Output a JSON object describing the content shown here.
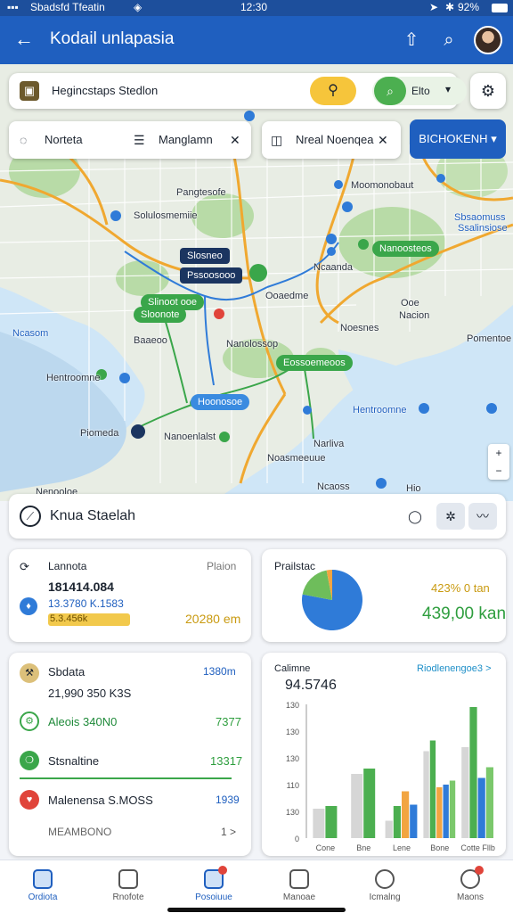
{
  "status": {
    "carrier": "Sbadsfd Tfeatin",
    "time": "12:30",
    "battery": "92%"
  },
  "app": {
    "title": "Kodail unlapasia"
  },
  "search": {
    "value": "Hegincstaps Stedlon",
    "go_label": "Elto"
  },
  "chips": [
    {
      "label": "Norteta"
    },
    {
      "label": "Manglamn"
    },
    {
      "label": "Nreal Noenqea"
    }
  ],
  "directions": {
    "label": "BICHOKENH"
  },
  "map_labels": {
    "l1": "Pangtesofe",
    "l2": "Solulosmemiie",
    "l3": "Moomonobaut",
    "l4": "Sbsaomuss",
    "l5": "Ssalinsiose",
    "l6": "Ncaanda",
    "l7": "Ooaedme",
    "l8": "Ooe",
    "l9": "Nacion",
    "l10": "Noesnes",
    "l11": "Nanolossop",
    "l12": "Pomentoe",
    "l13": "Ncasom",
    "l14": "Hentroomne",
    "l15": "Piomeda",
    "l16": "Nanoenlalst",
    "l17": "Narliva",
    "l18": "Noasmeeuue",
    "l19": "Ncaoss",
    "l20": "Nenooloe",
    "l21": "Hio",
    "l22": "Baaeoo"
  },
  "map_pills": {
    "p1": "Slosneo",
    "p2": "Pssoosooo",
    "p3": "Slinoot ooe",
    "p4": "Sloonote",
    "p5": "Nanoosteos",
    "p6": "Eossoemeoos",
    "p7": "Hoonosoe"
  },
  "location": {
    "title": "Knua Staelah"
  },
  "stats_card": {
    "label": "Lannota",
    "sub": "Plaion",
    "v1": "181414.084",
    "v2": "13.3780 K.1583",
    "v3": "5.3.456k",
    "v4": "20280 em"
  },
  "pie_card": {
    "title": "Prailstac",
    "pct": "423% 0 tan",
    "total": "439,00 kan"
  },
  "list_card": {
    "rows": [
      {
        "label": "Sbdata",
        "value": "1380m",
        "sub": "21,990 350 K3S"
      },
      {
        "label": "Aleois 340N0",
        "value": "7377"
      },
      {
        "label": "Stsnaltine",
        "value": "13317"
      },
      {
        "label": "Malenensa S.MOSS",
        "value": "1939"
      },
      {
        "label": "MEAMBONO",
        "value": "1 >"
      }
    ]
  },
  "chart_card": {
    "title": "Calimne",
    "link": "Riodlenengoe3 >",
    "big_value": "94.5746"
  },
  "chart_data": {
    "type": "bar",
    "categories": [
      "Cone",
      "Bne",
      "Lene",
      "Bone",
      "Cotte Fllb"
    ],
    "ylim": [
      0,
      1
    ],
    "yticks": [
      "0",
      "130",
      "110",
      "130",
      "130",
      "130"
    ],
    "series": [
      {
        "color": "#d6d6d6",
        "values": [
          0.22,
          0.48,
          0.13,
          0.65,
          0.68
        ]
      },
      {
        "color": "#4caf50",
        "values": [
          0.24,
          0.52,
          0.24,
          0.73,
          0.98
        ]
      },
      {
        "color": "#f2a541",
        "values": [
          0,
          0,
          0.35,
          0.38,
          0
        ]
      },
      {
        "color": "#2f7bd8",
        "values": [
          0,
          0,
          0.25,
          0.4,
          0.45
        ]
      },
      {
        "color": "#7bc86c",
        "values": [
          0,
          0,
          0,
          0.43,
          0.53
        ]
      }
    ]
  },
  "pie_data": {
    "type": "pie",
    "slices": [
      {
        "value": 0.78,
        "color": "#2f7bd8"
      },
      {
        "value": 0.19,
        "color": "#6ebd5b"
      },
      {
        "value": 0.03,
        "color": "#f2a541"
      }
    ]
  },
  "nav": [
    {
      "label": "Ordiota"
    },
    {
      "label": "Rnofote"
    },
    {
      "label": "Posoiuue"
    },
    {
      "label": "Manoae"
    },
    {
      "label": "Icmalng"
    },
    {
      "label": "Maons"
    }
  ]
}
